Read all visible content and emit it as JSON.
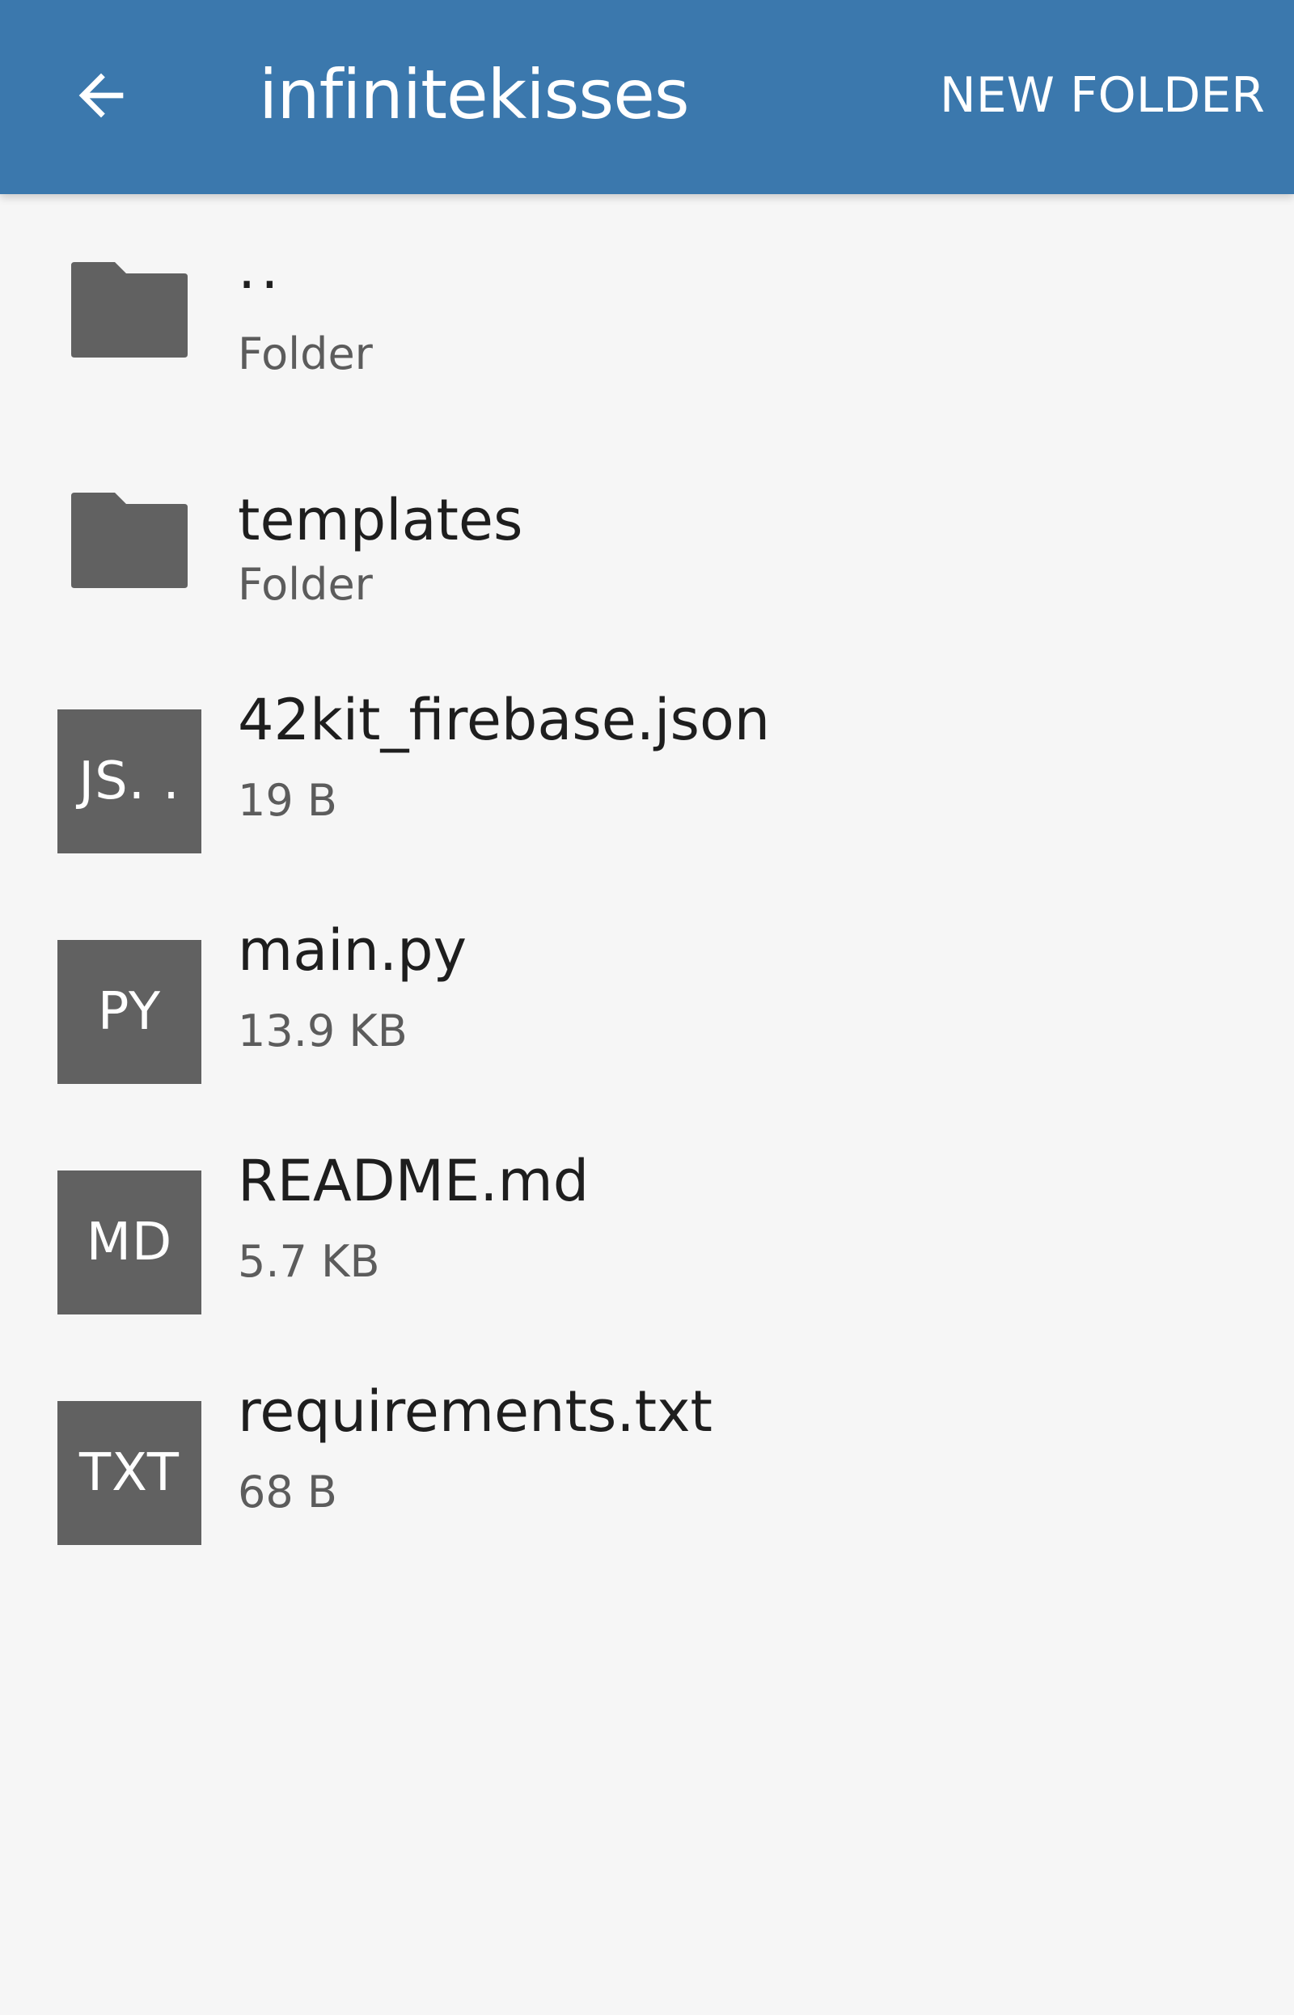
{
  "appbar": {
    "back_icon": "arrow-left-icon",
    "title": "infinitekisses",
    "new_folder_label": "NEW FOLDER",
    "background_color": "#3b78ad"
  },
  "items": [
    {
      "kind": "folder",
      "icon": "folder-icon",
      "name": "..",
      "detail": "Folder"
    },
    {
      "kind": "folder",
      "icon": "folder-icon",
      "name": "templates",
      "detail": "Folder"
    },
    {
      "kind": "file",
      "badge": "JS. .",
      "name": "42kit_firebase.json",
      "detail": "19 B"
    },
    {
      "kind": "file",
      "badge": "PY",
      "name": "main.py",
      "detail": "13.9 KB"
    },
    {
      "kind": "file",
      "badge": "MD",
      "name": "README.md",
      "detail": "5.7 KB"
    },
    {
      "kind": "file",
      "badge": "TXT",
      "name": "requirements.txt",
      "detail": "68 B"
    }
  ]
}
